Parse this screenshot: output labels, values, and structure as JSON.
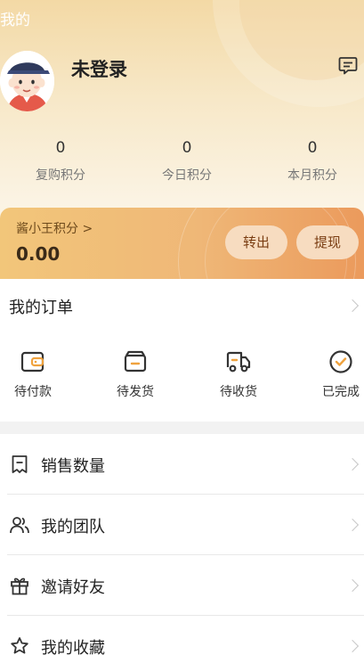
{
  "header": {
    "title": "我的"
  },
  "profile": {
    "name": "未登录"
  },
  "stats": [
    {
      "value": "0",
      "label": "复购积分"
    },
    {
      "value": "0",
      "label": "今日积分"
    },
    {
      "value": "0",
      "label": "本月积分"
    }
  ],
  "points": {
    "title": "酱小王积分 >",
    "value": "0.00",
    "transfer_label": "转出",
    "withdraw_label": "提现"
  },
  "orders": {
    "title": "我的订单",
    "items": [
      {
        "label": "待付款",
        "icon": "wallet-icon"
      },
      {
        "label": "待发货",
        "icon": "box-icon"
      },
      {
        "label": "待收货",
        "icon": "truck-icon"
      },
      {
        "label": "已完成",
        "icon": "check-circle-icon"
      }
    ]
  },
  "menu": [
    {
      "label": "销售数量",
      "icon": "receipt-icon"
    },
    {
      "label": "我的团队",
      "icon": "team-icon"
    },
    {
      "label": "邀请好友",
      "icon": "gift-icon"
    },
    {
      "label": "我的收藏",
      "icon": "star-icon"
    }
  ],
  "colors": {
    "accent": "#efb777",
    "brand_dark": "#7a3d12",
    "icon_dark": "#333333"
  }
}
